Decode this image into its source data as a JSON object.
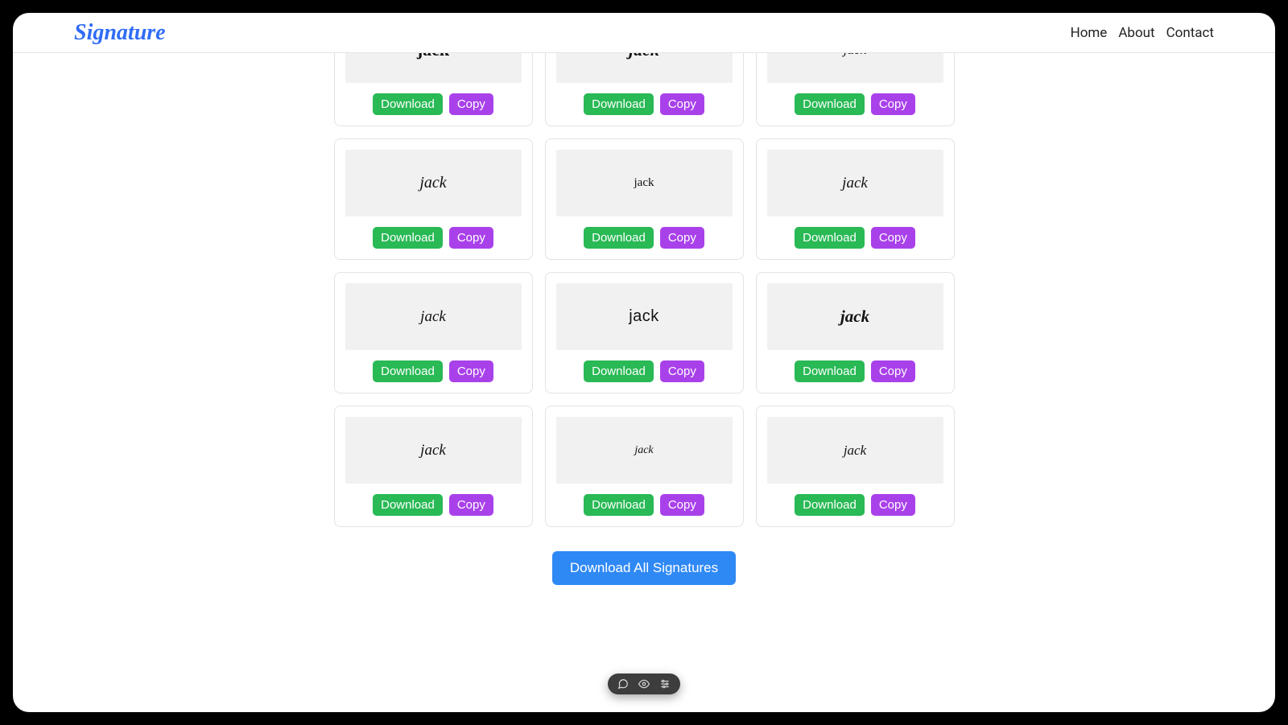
{
  "header": {
    "logo": "Signature",
    "nav": [
      "Home",
      "About",
      "Contact"
    ]
  },
  "buttons": {
    "download": "Download",
    "copy": "Copy",
    "download_all": "Download All Signatures"
  },
  "signature_text": "jack",
  "cards": [
    {
      "font_class": "f1"
    },
    {
      "font_class": "f2"
    },
    {
      "font_class": "f3"
    },
    {
      "font_class": "f4"
    },
    {
      "font_class": "f5"
    },
    {
      "font_class": "f6"
    },
    {
      "font_class": "f7"
    },
    {
      "font_class": "f8"
    },
    {
      "font_class": "f9"
    },
    {
      "font_class": "f10"
    },
    {
      "font_class": "f11"
    },
    {
      "font_class": "f12"
    }
  ]
}
